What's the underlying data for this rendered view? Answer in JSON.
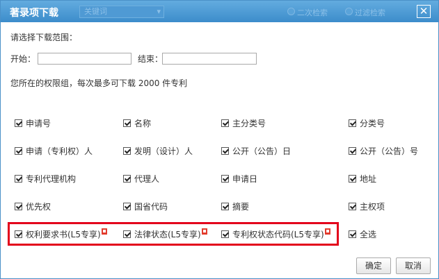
{
  "dialog": {
    "title": "著录项下载",
    "bg_select_value": "关键词",
    "bg_radio_1": "二次检索",
    "bg_radio_2": "过滤检索",
    "close_symbol": "✕"
  },
  "range": {
    "prompt": "请选择下载范围：",
    "start_label": "开始：",
    "start_value": "",
    "end_label": "结束：",
    "end_value": "",
    "limit_note": "您所在的权限组，每次最多可下载 2000 件专利"
  },
  "fields": {
    "row1": [
      "申请号",
      "名称",
      "主分类号",
      "分类号"
    ],
    "row2": [
      "申请（专利权）人",
      "发明（设计）人",
      "公开（公告）日",
      "公开（公告）号"
    ],
    "row3": [
      "专利代理机构",
      "代理人",
      "申请日",
      "地址"
    ],
    "row4": [
      "优先权",
      "国省代码",
      "摘要",
      "主权项"
    ],
    "row5": [
      "权利要求书(L5专享)",
      "法律状态(L5专享)",
      "专利权状态代码(L5专享)",
      "全选"
    ]
  },
  "buttons": {
    "ok": "确定",
    "cancel": "取消"
  },
  "colors": {
    "title_bar": "#3c8ccb",
    "highlight_border": "#e3001b",
    "premium_flag": "#e23b2d"
  }
}
